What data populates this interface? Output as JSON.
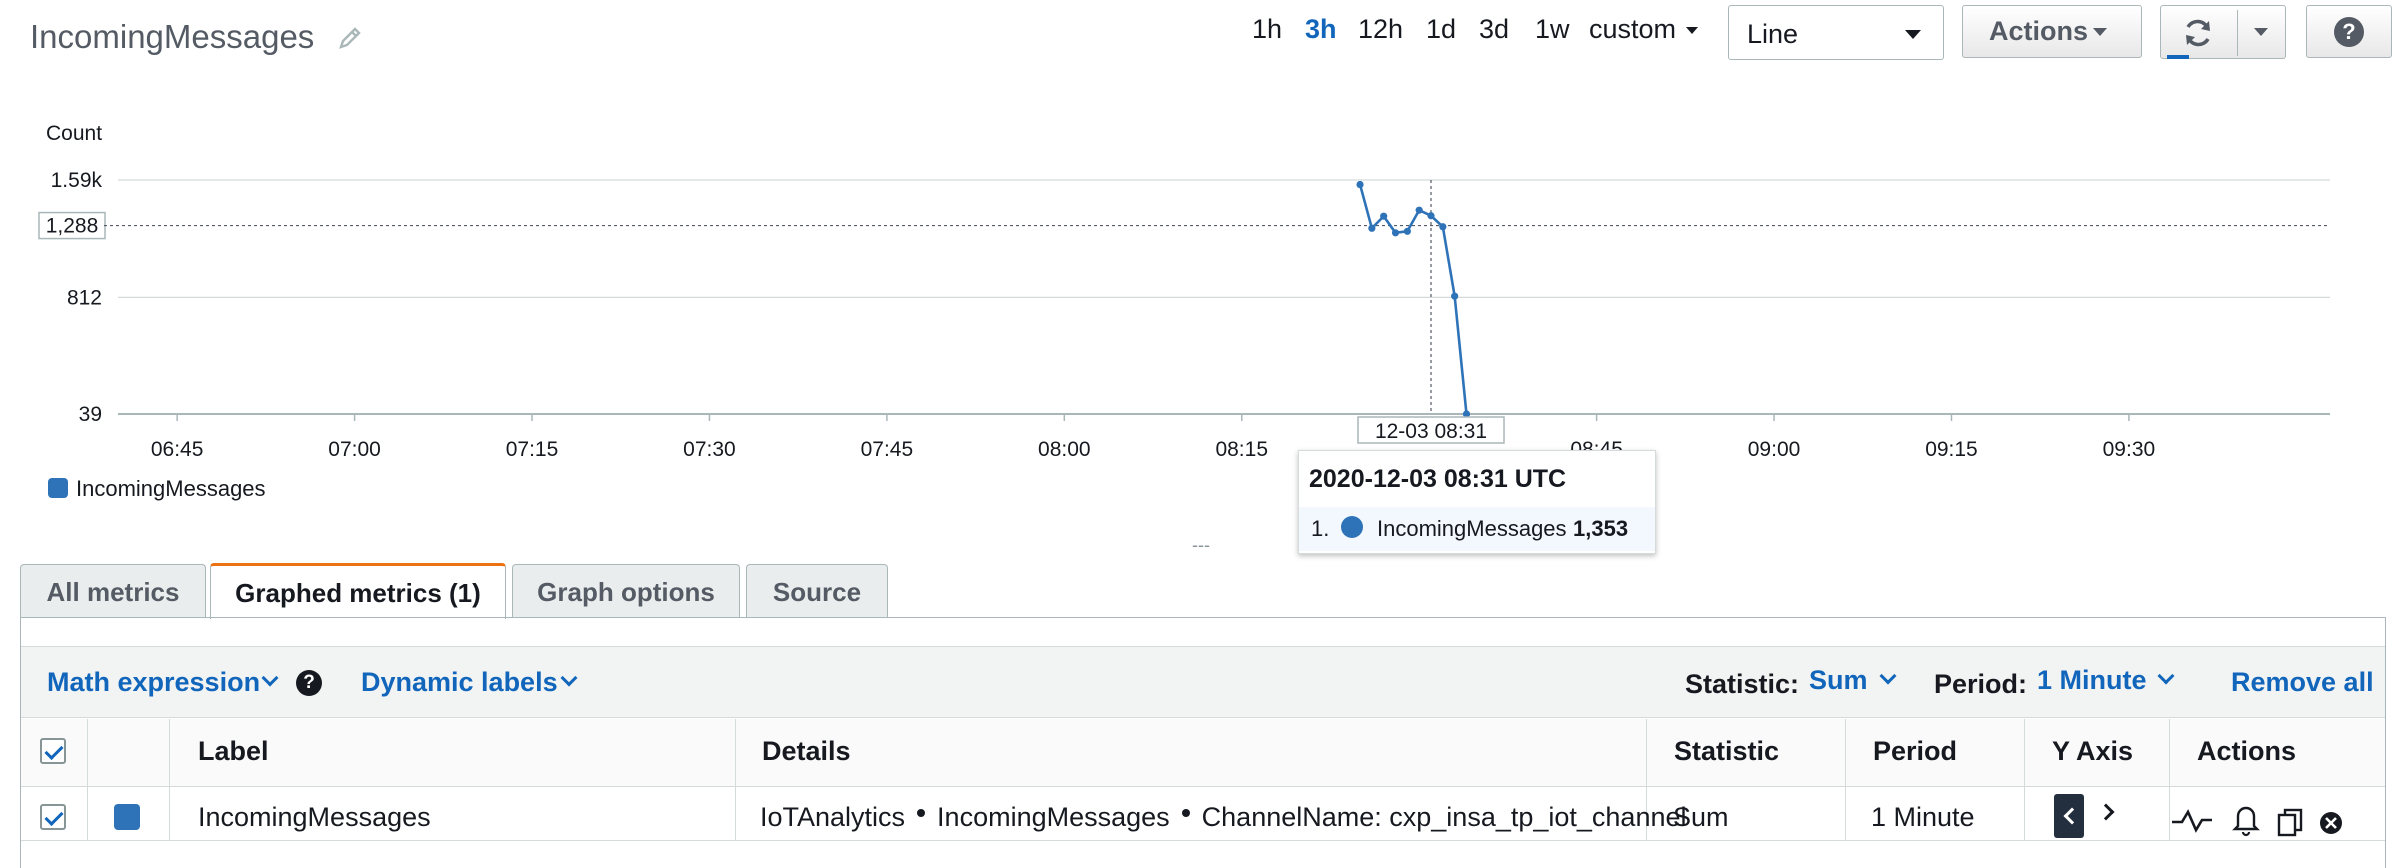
{
  "header": {
    "title": "IncomingMessages",
    "time_ranges": [
      "1h",
      "3h",
      "12h",
      "1d",
      "3d",
      "1w",
      "custom"
    ],
    "active_range": "3h",
    "graph_type": "Line",
    "actions_label": "Actions",
    "help_label": "?"
  },
  "chart_data": {
    "type": "line",
    "ylabel": "Count",
    "y_ticks": [
      "1.59k",
      "812",
      "39"
    ],
    "y_tick_values": [
      1590,
      812,
      39
    ],
    "highlight_y_label": "1,288",
    "highlight_y_value": 1288,
    "ylim": [
      39,
      1590
    ],
    "x_ticks": [
      "06:45",
      "07:00",
      "07:15",
      "07:30",
      "07:45",
      "08:00",
      "08:15",
      "08:45",
      "09:00",
      "09:15",
      "09:30"
    ],
    "xlim": [
      "06:40",
      "09:47"
    ],
    "cursor_label": "12-03 08:31",
    "grid": "horizontal dotted",
    "legend_position": "bottom-left",
    "series": [
      {
        "name": "IncomingMessages",
        "color": "#2e73b8",
        "x": [
          "08:25",
          "08:26",
          "08:27",
          "08:28",
          "08:29",
          "08:30",
          "08:31",
          "08:32",
          "08:33",
          "08:34"
        ],
        "y": [
          1560,
          1270,
          1350,
          1240,
          1250,
          1390,
          1353,
          1280,
          820,
          39
        ]
      }
    ]
  },
  "legend": {
    "label": "IncomingMessages"
  },
  "tooltip": {
    "title": "2020-12-03 08:31 UTC",
    "index": "1.",
    "metric": "IncomingMessages",
    "value": "1,353"
  },
  "drag_handle": "---",
  "tabs": [
    "All metrics",
    "Graphed metrics (1)",
    "Graph options",
    "Source"
  ],
  "active_tab": "Graphed metrics (1)",
  "toolbar": {
    "math_expression": "Math expression",
    "dynamic_labels": "Dynamic labels",
    "statistic_label": "Statistic:",
    "statistic_value": "Sum",
    "period_label": "Period:",
    "period_value": "1 Minute",
    "remove_all": "Remove all"
  },
  "table": {
    "columns": [
      "Label",
      "Details",
      "Statistic",
      "Period",
      "Y Axis",
      "Actions"
    ],
    "rows": [
      {
        "label": "IncomingMessages",
        "details": [
          "IoTAnalytics",
          "IncomingMessages",
          "ChannelName: cxp_insa_tp_iot_channel"
        ],
        "statistic": "Sum",
        "period": "1 Minute",
        "color": "#2e73b8"
      }
    ]
  }
}
